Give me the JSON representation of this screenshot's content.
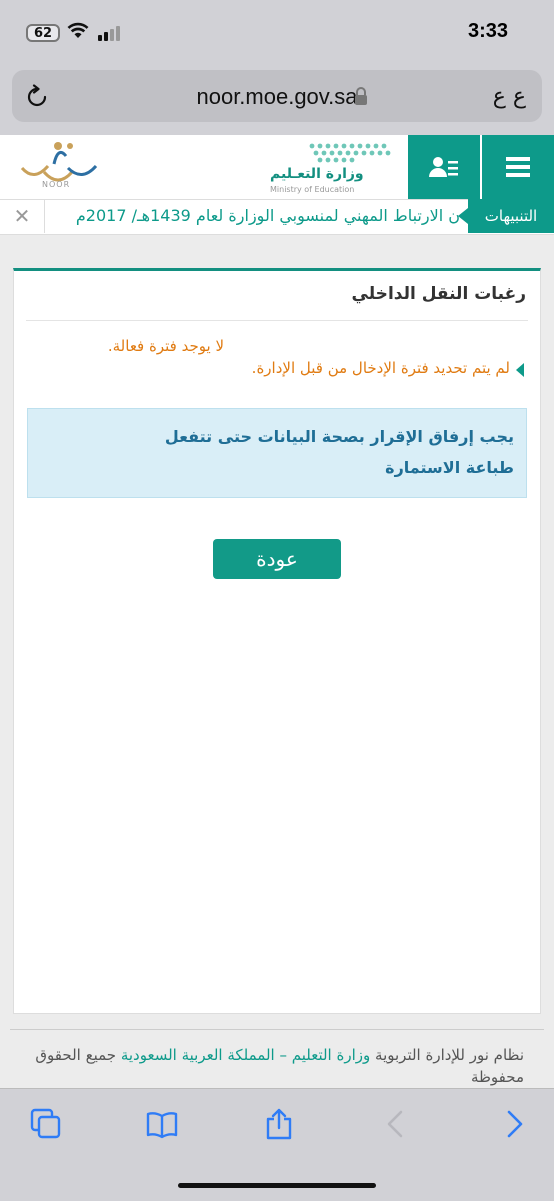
{
  "status_bar": {
    "time": "3:33",
    "battery": "62"
  },
  "browser": {
    "url": "noor.moe.gov.sa",
    "text_size_label": "ع ع"
  },
  "header": {
    "ministry_name_ar": "وزارة التعـليم",
    "ministry_name_en": "Ministry of Education",
    "noor_label": "NOOR"
  },
  "ticker": {
    "label": "التنبيهات",
    "text": "ن الارتباط المهني لمنسوبي الوزارة لعام 1439هـ/ 2017م",
    "close": "✕"
  },
  "panel": {
    "title": "رغبات النقل الداخلي",
    "message_1": "لا يوجد فترة فعالة.",
    "message_2": "لم يتم تحديد فترة الإدخال من قبل الإدارة.",
    "info": "يجب إرفاق الإقرار بصحة البيانات حتى تتفعل طباعة الاستمارة",
    "back_button": "عودة"
  },
  "footer": {
    "part_1": "نظام نور للإدارة التربوية ",
    "link": "وزارة التعليم – المملكة العربية السعودية",
    "part_2": " جميع الحقوق محفوظة"
  },
  "colors": {
    "accent": "#0d9a8a",
    "warning_text": "#e07b12",
    "info_bg": "#d9eef7",
    "info_text": "#1f6e96",
    "ios_blue": "#2f7cf6"
  },
  "icons": [
    "reload-icon",
    "lock-icon",
    "menu-icon",
    "user-list-icon",
    "close-icon",
    "tabs-icon",
    "bookmarks-icon",
    "share-icon",
    "back-arrow-icon",
    "forward-arrow-icon"
  ]
}
